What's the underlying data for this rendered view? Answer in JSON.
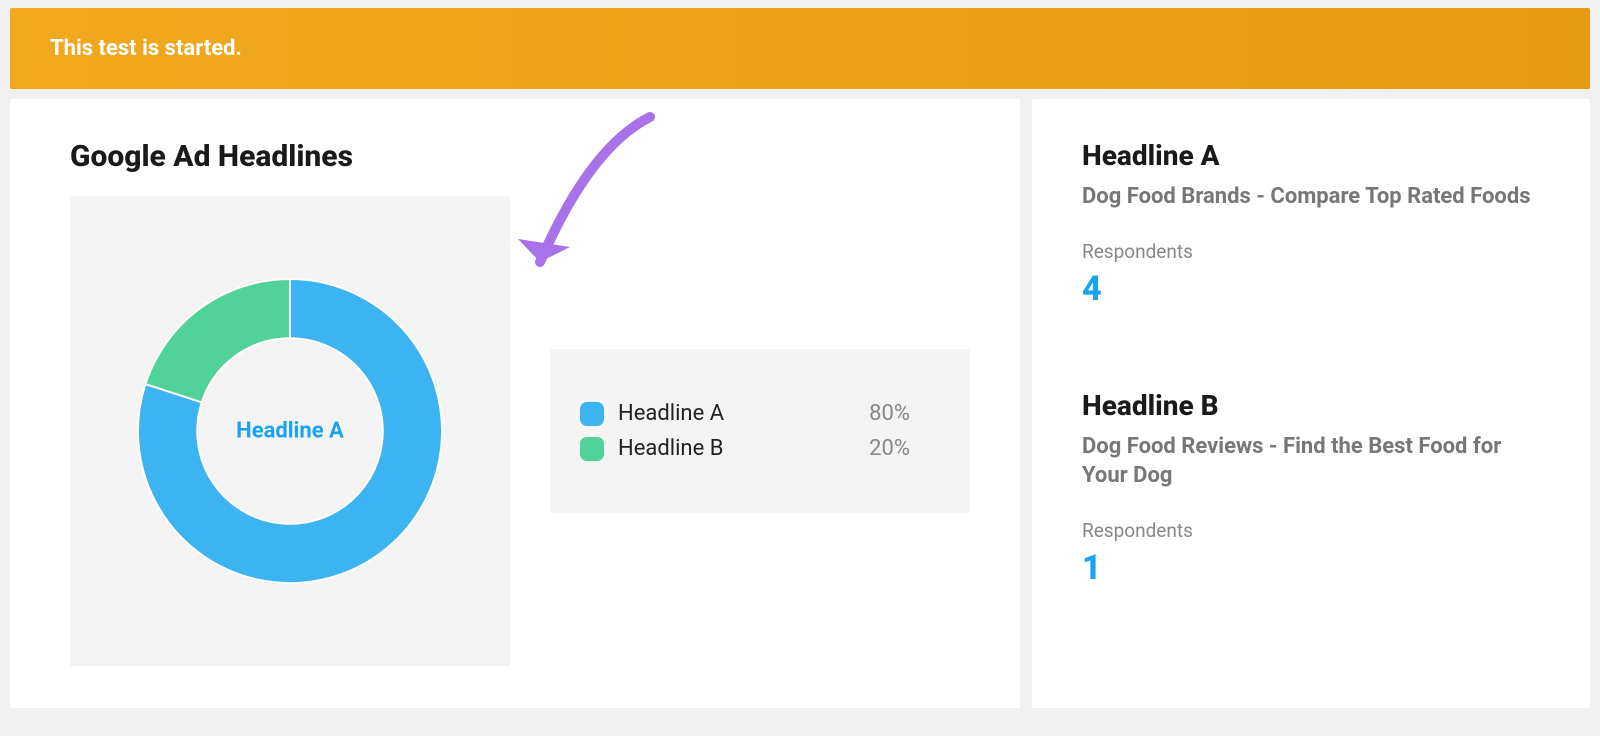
{
  "banner": {
    "text": "This test is started."
  },
  "section": {
    "title": "Google Ad Headlines"
  },
  "chart_data": {
    "type": "pie",
    "title": "Google Ad Headlines",
    "categories": [
      "Headline A",
      "Headline B"
    ],
    "values": [
      80,
      20
    ],
    "series": [
      {
        "name": "Headline A",
        "value": 80,
        "color": "#3db4f2"
      },
      {
        "name": "Headline B",
        "value": 20,
        "color": "#52d29b"
      }
    ],
    "center_label": "Headline A",
    "donut": true
  },
  "legend": {
    "items": [
      {
        "label": "Headline A",
        "pct": "80%",
        "color": "#3db4f2"
      },
      {
        "label": "Headline B",
        "pct": "20%",
        "color": "#52d29b"
      }
    ]
  },
  "headlines": [
    {
      "title": "Headline A",
      "subtitle": "Dog Food Brands - Compare Top Rated Foods",
      "respondents_label": "Respondents",
      "respondents_value": "4"
    },
    {
      "title": "Headline B",
      "subtitle": "Dog Food Reviews - Find the Best Food for Your Dog",
      "respondents_label": "Respondents",
      "respondents_value": "1"
    }
  ],
  "colors": {
    "accent": "#1aa3f0",
    "arrow": "#a873e8"
  }
}
